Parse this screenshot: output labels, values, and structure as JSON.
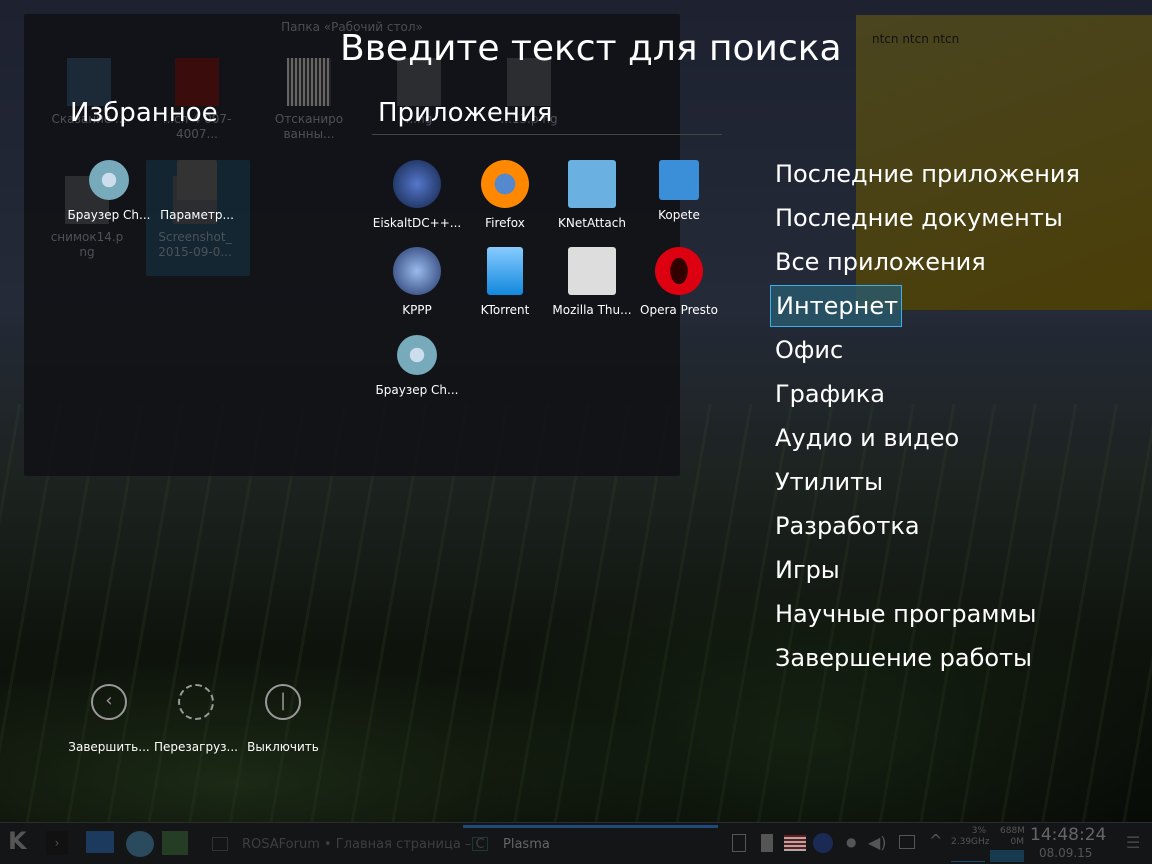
{
  "folder": {
    "title": "Папка «Рабочий стол»",
    "items": [
      "Сказание ...",
      "...ch-4 007-4007...",
      "Отсканиро ванны...",
      "...ng",
      "...13.p ng",
      "снимок14.p ng",
      "Screenshot_ 2015-09-0..."
    ]
  },
  "search_placeholder": "Введите текст для поиска",
  "favorites": {
    "title": "Избранное",
    "items": [
      "Браузер Ch...",
      "Параметр..."
    ]
  },
  "apps": {
    "title": "Приложения",
    "items": [
      "EiskaltDC++...",
      "Firefox",
      "KNetAttach",
      "Kopete",
      "KPPP",
      "KTorrent",
      "Mozilla Thu...",
      "Opera Presto",
      "Браузер Ch..."
    ]
  },
  "categories": [
    "Последние приложения",
    "Последние документы",
    "Все приложения",
    "Интернет",
    "Офис",
    "Графика",
    "Аудио и видео",
    "Утилиты",
    "Разработка",
    "Игры",
    "Научные программы",
    "Завершение работы"
  ],
  "active_category": "Интернет",
  "power": [
    "Завершить...",
    "Перезагруз...",
    "Выключить"
  ],
  "note": "ntcn ntcn ntcn",
  "taskbar": {
    "task1": "ROSAForum • Главная страница – C",
    "task2": "Plasma",
    "cpu": "3%",
    "freq": "2.39GHz",
    "mem": "688M",
    "swap": "0M",
    "time": "14:48:24",
    "date": "08.09.15"
  }
}
